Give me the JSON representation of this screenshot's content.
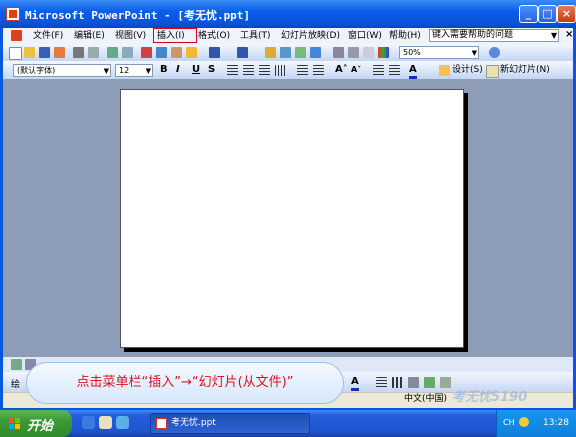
{
  "window": {
    "title": "Microsoft PowerPoint - [考无忧.ppt]",
    "controls": [
      "_",
      "□",
      "×"
    ]
  },
  "menubar": {
    "items": [
      {
        "label": "文件(F)"
      },
      {
        "label": "编辑(E)"
      },
      {
        "label": "视图(V)"
      },
      {
        "label": "插入(I)"
      },
      {
        "label": "格式(O)"
      },
      {
        "label": "工具(T)"
      },
      {
        "label": "幻灯片放映(D)"
      },
      {
        "label": "窗口(W)"
      },
      {
        "label": "帮助(H)"
      }
    ],
    "help_placeholder": "键入需要帮助的问题",
    "doc_close": "×"
  },
  "toolbar_standard": {
    "zoom": "50%"
  },
  "toolbar_formatting": {
    "font_name": "(默认字体)",
    "font_size": "12",
    "bold": "B",
    "italic": "I",
    "underline": "U",
    "shadow": "S",
    "design_label": "设计(S)",
    "new_slide_label": "新幻灯片(N)"
  },
  "drawing_toolbar": {
    "label": "绘"
  },
  "callout": {
    "text": "点击菜单栏“插入”→“幻灯片(从文件)”"
  },
  "statusbar": {
    "language": "中文(中国)"
  },
  "watermark": {
    "text": "考无忧5190"
  },
  "taskbar": {
    "start_label": "开始",
    "task_button_label": "考无忧.ppt",
    "tray_lang": "CH",
    "clock": "13:28"
  },
  "colors": {
    "title_bar": "#0A54E2",
    "workspace": "#8D9DB7",
    "highlight": "#d6001c",
    "callout_text": "#e0101f",
    "taskbar": "#245EDC",
    "start_button": "#3B9A36"
  }
}
